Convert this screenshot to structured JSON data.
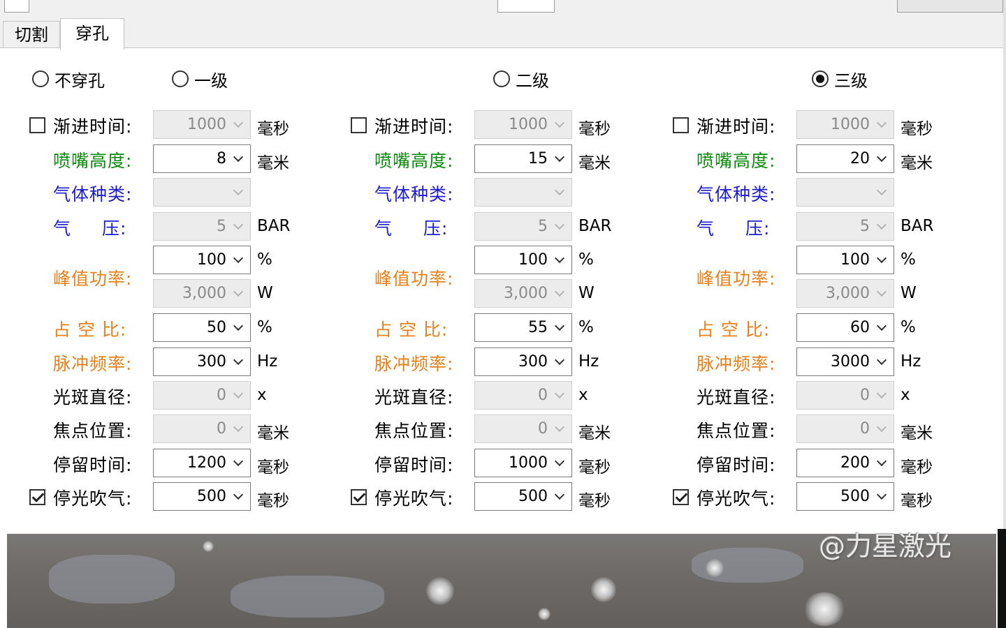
{
  "tabs": [
    {
      "label": "切割",
      "active": false
    },
    {
      "label": "穿孔",
      "active": true
    }
  ],
  "levels": [
    {
      "label": "不穿孔",
      "selected": false
    },
    {
      "label": "一级",
      "selected": false
    },
    {
      "label": "二级",
      "selected": false
    },
    {
      "label": "三级",
      "selected": true
    }
  ],
  "labels": {
    "ramp_time": "渐进时间:",
    "nozzle_height": "喷嘴高度:",
    "gas_type": "气体种类:",
    "gas_pressure_1": "气",
    "gas_pressure_2": "压:",
    "peak_power": "峰值功率:",
    "duty_cycle": "占 空 比:",
    "pulse_freq": "脉冲频率:",
    "spot_diameter": "光斑直径:",
    "focus_position": "焦点位置:",
    "dwell_time": "停留时间:",
    "stop_blow": "停光吹气:"
  },
  "units": {
    "ms": "毫秒",
    "mm": "毫米",
    "bar": "BAR",
    "percent": "%",
    "watt": "W",
    "hz": "Hz",
    "x": "x"
  },
  "colors": {
    "green": "#0a8a0a",
    "blue": "#1c1ccc",
    "orange": "#e8801a"
  },
  "columns": [
    {
      "ramp_enabled": false,
      "ramp_time": "1000",
      "nozzle_height": "8",
      "gas_type": "",
      "gas_pressure": "5",
      "peak_power_pct": "100",
      "peak_power_w": "3,000",
      "duty_cycle": "50",
      "pulse_freq": "300",
      "spot_diameter": "0",
      "focus_position": "0",
      "dwell_time": "1200",
      "stop_blow_enabled": true,
      "stop_blow": "500"
    },
    {
      "ramp_enabled": false,
      "ramp_time": "1000",
      "nozzle_height": "15",
      "gas_type": "",
      "gas_pressure": "5",
      "peak_power_pct": "100",
      "peak_power_w": "3,000",
      "duty_cycle": "55",
      "pulse_freq": "300",
      "spot_diameter": "0",
      "focus_position": "0",
      "dwell_time": "1000",
      "stop_blow_enabled": true,
      "stop_blow": "500"
    },
    {
      "ramp_enabled": false,
      "ramp_time": "1000",
      "nozzle_height": "20",
      "gas_type": "",
      "gas_pressure": "5",
      "peak_power_pct": "100",
      "peak_power_w": "3,000",
      "duty_cycle": "60",
      "pulse_freq": "3000",
      "spot_diameter": "0",
      "focus_position": "0",
      "dwell_time": "200",
      "stop_blow_enabled": true,
      "stop_blow": "500"
    }
  ],
  "watermark": "@力星激光"
}
